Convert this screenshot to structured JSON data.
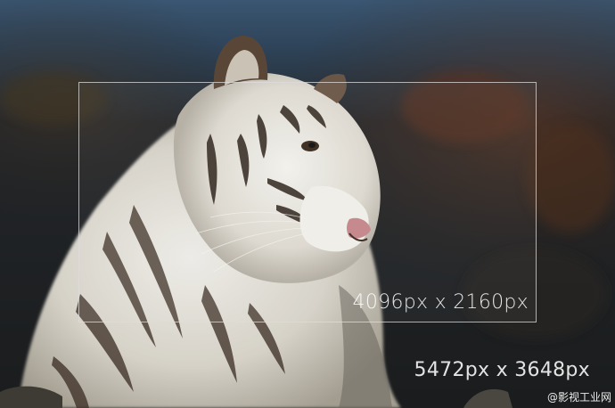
{
  "labels": {
    "inner_resolution": "4096px x 2160px",
    "outer_resolution": "5472px x 3648px"
  },
  "watermark": "@影视工业网"
}
